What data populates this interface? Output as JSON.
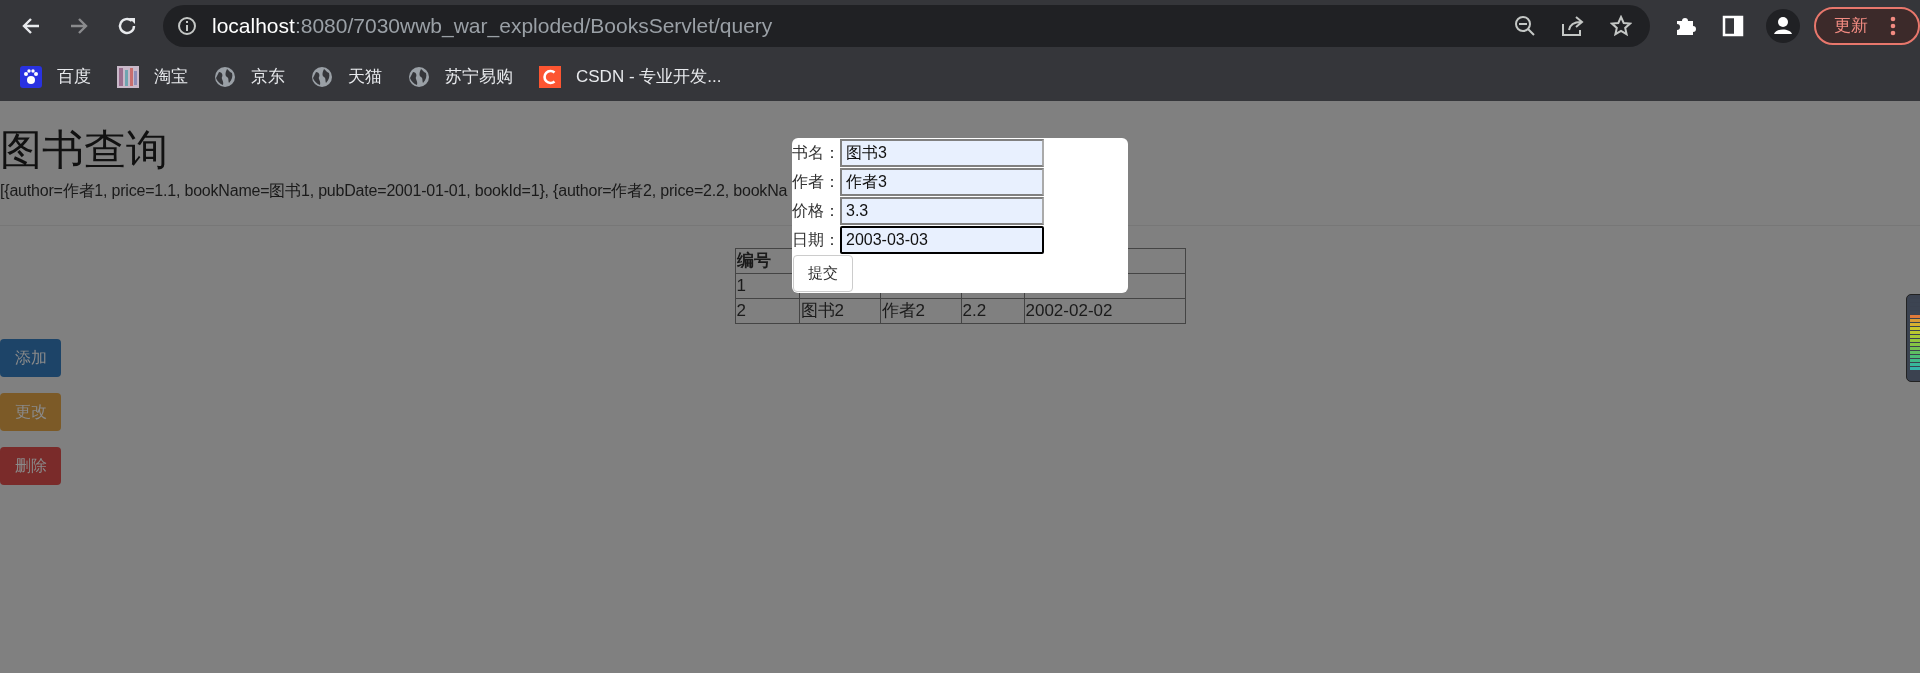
{
  "browser": {
    "nav_buttons": [
      {
        "kind": "back",
        "disabled": false
      },
      {
        "kind": "forward",
        "disabled": true
      },
      {
        "kind": "reload",
        "disabled": false
      }
    ],
    "url": {
      "host": "localhost",
      "path": ":8080/7030wwb_war_exploded/BooksServlet/query"
    },
    "update_button": "更新",
    "bookmarks": [
      {
        "kind": "paw",
        "label": "百度"
      },
      {
        "kind": "mosaic",
        "label": "淘宝"
      },
      {
        "kind": "globe",
        "label": "京东"
      },
      {
        "kind": "globe",
        "label": "天猫"
      },
      {
        "kind": "globe",
        "label": "苏宁易购"
      },
      {
        "kind": "c",
        "label": "CSDN - 专业开发..."
      }
    ]
  },
  "page": {
    "title": "图书查询",
    "data_text": "[{author=作者1, price=1.1, bookName=图书1, pubDate=2001-01-01, bookId=1}, {author=作者2, price=2.2, bookNa",
    "table": {
      "columns": [
        "编号"
      ],
      "rows": [
        [
          "1"
        ],
        [
          "2",
          "图书2",
          "作者2",
          "2.2",
          "2002-02-02"
        ]
      ]
    },
    "buttons": [
      {
        "label": "添加",
        "color": "#1d4468"
      },
      {
        "label": "更改",
        "color": "#7c5a27"
      },
      {
        "label": "删除",
        "color": "#7a2b2a"
      }
    ]
  },
  "dialog": {
    "fields": [
      {
        "label": "书名：",
        "value": "图书3",
        "focused": false
      },
      {
        "label": "作者：",
        "value": "作者3",
        "focused": false
      },
      {
        "label": "价格：",
        "value": "3.3",
        "focused": false
      },
      {
        "label": "日期：",
        "value": "2003-03-03",
        "focused": true
      }
    ],
    "submit": "提交"
  }
}
